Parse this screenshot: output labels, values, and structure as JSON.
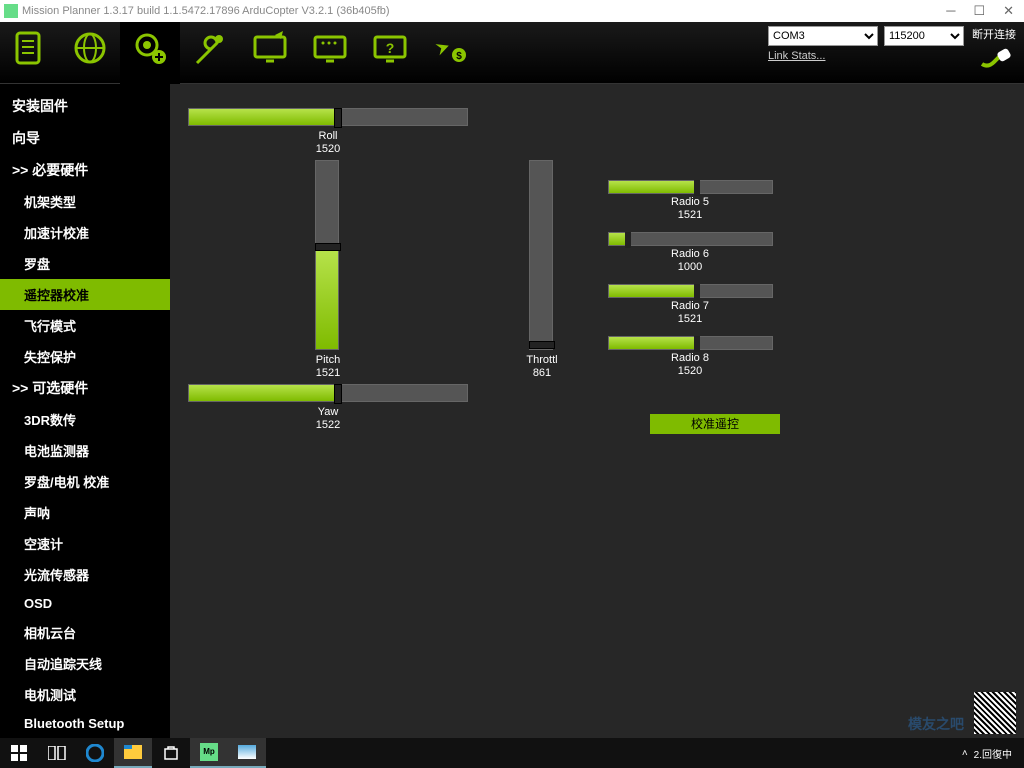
{
  "title": "Mission Planner 1.3.17 build 1.1.5472.17896 ArduCopter V3.2.1 (36b405fb)",
  "topnav": {
    "items": [
      {
        "label": "飞行数据"
      },
      {
        "label": "飞行计划"
      },
      {
        "label": "初始设置"
      },
      {
        "label": "配置/调试"
      },
      {
        "label": "模拟"
      },
      {
        "label": "终端"
      },
      {
        "label": "帮助"
      },
      {
        "label": "捐赠"
      }
    ],
    "com_port": "COM3",
    "baud": "115200",
    "disconnect": "断开连接",
    "link_stats": "Link Stats..."
  },
  "sidebar": {
    "items": [
      {
        "label": "安装固件",
        "sub": false
      },
      {
        "label": "向导",
        "sub": false
      },
      {
        "label": ">> 必要硬件",
        "sub": false
      },
      {
        "label": "机架类型",
        "sub": true
      },
      {
        "label": "加速计校准",
        "sub": true
      },
      {
        "label": "罗盘",
        "sub": true
      },
      {
        "label": "遥控器校准",
        "sub": true,
        "selected": true
      },
      {
        "label": "飞行模式",
        "sub": true
      },
      {
        "label": "失控保护",
        "sub": true
      },
      {
        "label": ">> 可选硬件",
        "sub": false
      },
      {
        "label": "3DR数传",
        "sub": true
      },
      {
        "label": "电池监测器",
        "sub": true
      },
      {
        "label": "罗盘/电机 校准",
        "sub": true
      },
      {
        "label": "声呐",
        "sub": true
      },
      {
        "label": "空速计",
        "sub": true
      },
      {
        "label": "光流传感器",
        "sub": true
      },
      {
        "label": "OSD",
        "sub": true
      },
      {
        "label": "相机云台",
        "sub": true
      },
      {
        "label": "自动追踪天线",
        "sub": true
      },
      {
        "label": "电机测试",
        "sub": true
      },
      {
        "label": "Bluetooth Setup",
        "sub": true
      }
    ]
  },
  "channels": {
    "roll": {
      "label": "Roll",
      "value": "1520",
      "pct": 52
    },
    "pitch": {
      "label": "Pitch",
      "value": "1521",
      "pct": 52
    },
    "yaw": {
      "label": "Yaw",
      "value": "1522",
      "pct": 52
    },
    "throttle": {
      "label": "Throttl",
      "value": "861",
      "pct": 0
    },
    "radio5": {
      "label": "Radio 5",
      "value": "1521",
      "pct": 52
    },
    "radio6": {
      "label": "Radio 6",
      "value": "1000",
      "pct": 10
    },
    "radio7": {
      "label": "Radio 7",
      "value": "1521",
      "pct": 52
    },
    "radio8": {
      "label": "Radio 8",
      "value": "1520",
      "pct": 52
    }
  },
  "calibrate_btn": "校准遥控",
  "tray": {
    "ime": "2.回復中"
  },
  "watermark": "模友之吧"
}
